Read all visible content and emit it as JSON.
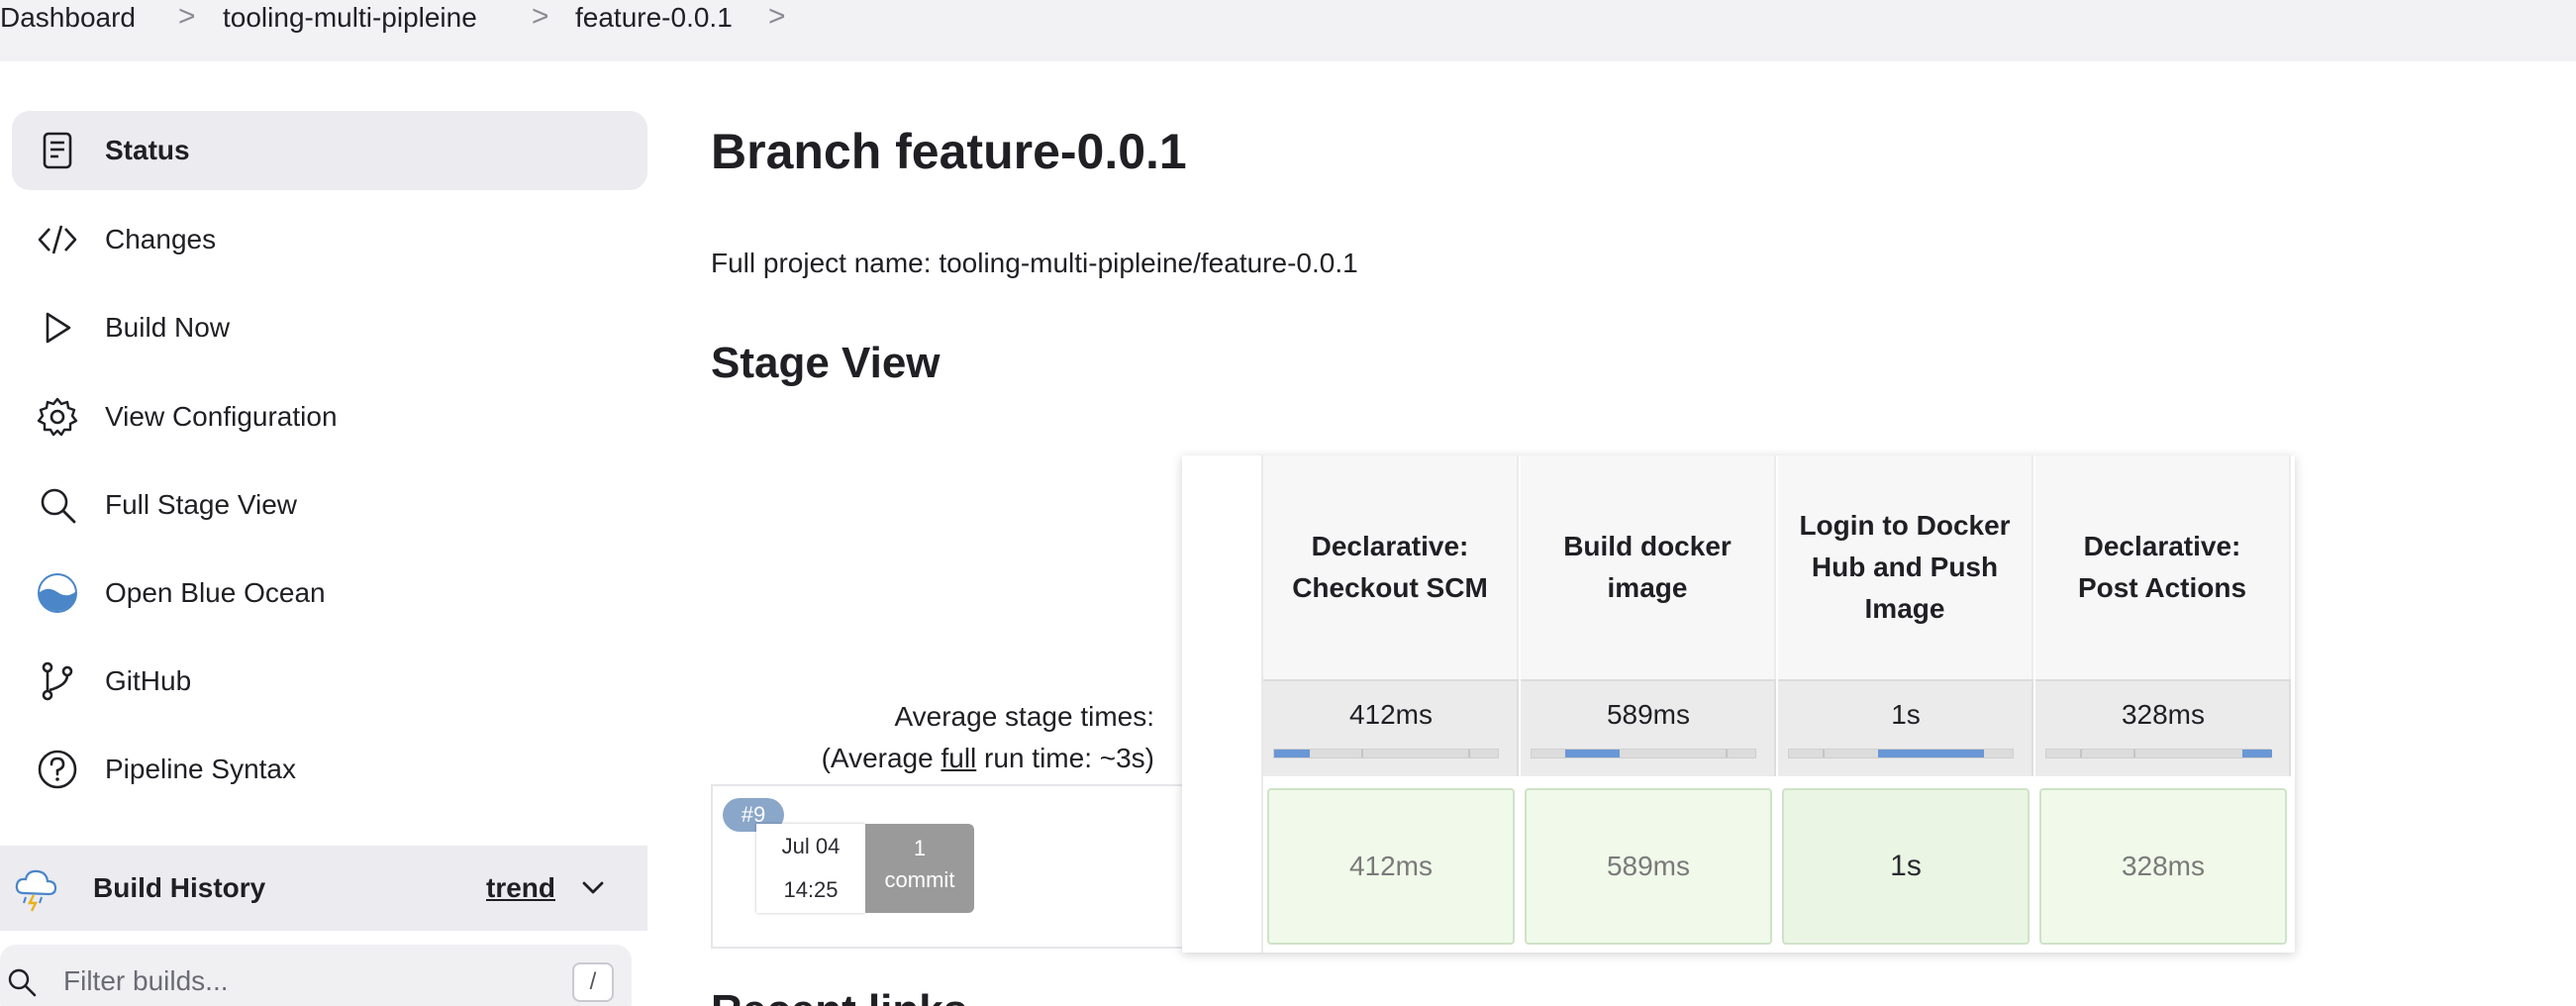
{
  "breadcrumb": {
    "items": [
      "Dashboard",
      "tooling-multi-pipleine",
      "feature-0.0.1"
    ],
    "separator": ">"
  },
  "sidebar": {
    "items": [
      {
        "label": "Status",
        "icon": "status-icon",
        "active": true
      },
      {
        "label": "Changes",
        "icon": "code-icon"
      },
      {
        "label": "Build Now",
        "icon": "play-icon"
      },
      {
        "label": "View Configuration",
        "icon": "gear-icon"
      },
      {
        "label": "Full Stage View",
        "icon": "search-icon"
      },
      {
        "label": "Open Blue Ocean",
        "icon": "blue-ocean-icon"
      },
      {
        "label": "GitHub",
        "icon": "git-branch-icon"
      },
      {
        "label": "Pipeline Syntax",
        "icon": "help-icon"
      }
    ],
    "build_history": {
      "title": "Build History",
      "trend_label": "trend",
      "icon": "weather-storm-icon"
    },
    "filter": {
      "placeholder": "Filter builds...",
      "shortcut": "/"
    }
  },
  "main": {
    "title": "Branch feature-0.0.1",
    "full_project_name": "Full project name: tooling-multi-pipleine/feature-0.0.1",
    "stage_view_heading": "Stage View",
    "next_heading": "Recent links",
    "avg_times_label": "Average stage times:",
    "avg_full_prefix": "(Average ",
    "avg_full_link": "full",
    "avg_full_suffix": " run time: ~3s)",
    "run": {
      "badge": "#9",
      "date": "Jul 04",
      "time": "14:25",
      "commit_count": "1",
      "commit_label": "commit"
    },
    "stages": [
      {
        "name": "Declarative: Checkout SCM",
        "avg": "412ms",
        "cell": "412ms",
        "bar_fraction": 0.16
      },
      {
        "name": "Build docker image",
        "avg": "589ms",
        "cell": "589ms",
        "bar_fraction": 0.24
      },
      {
        "name": "Login to Docker Hub and Push Image",
        "avg": "1s",
        "cell": "1s",
        "bar_fraction": 0.47
      },
      {
        "name": "Declarative: Post Actions",
        "avg": "328ms",
        "cell": "328ms",
        "bar_fraction": 0.13
      }
    ],
    "colors": {
      "bar_fill": "#6a97d6",
      "success_cell": "#f0f9ea",
      "badge": "#8aa6c9"
    }
  }
}
